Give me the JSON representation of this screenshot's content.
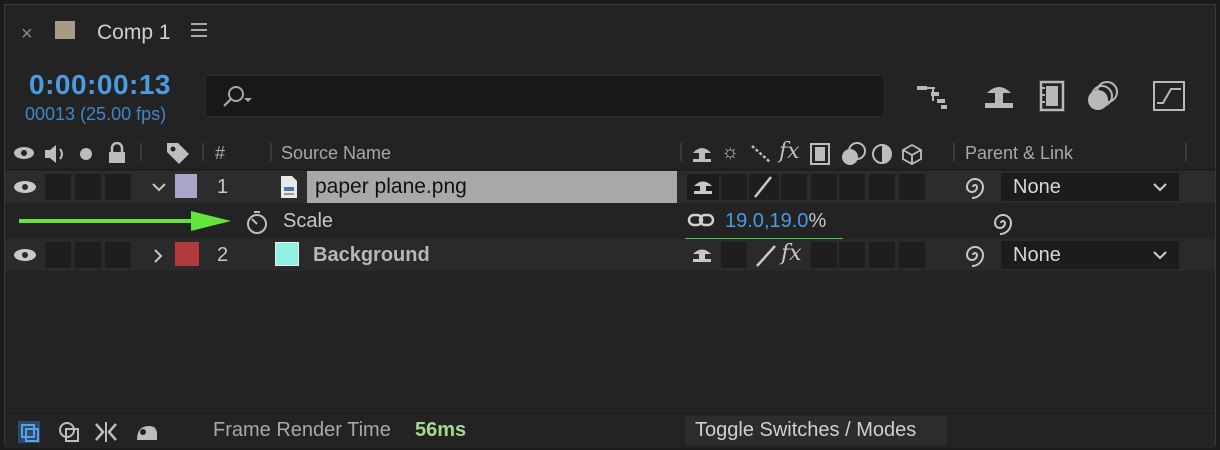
{
  "tab": {
    "close": "×",
    "title": "Comp 1",
    "swatch_color": "#a99a86"
  },
  "time": {
    "timecode": "0:00:00:13",
    "frames": "00013 (25.00 fps)"
  },
  "search": {
    "placeholder": ""
  },
  "toolbar": {
    "icons": [
      "composition-flowchart-icon",
      "draft-3d-icon",
      "frame-blending-icon",
      "motion-blur-icon",
      "graph-editor-icon"
    ]
  },
  "columns": {
    "index": "#",
    "source_name": "Source Name",
    "parent_link": "Parent & Link"
  },
  "layers": [
    {
      "number": "1",
      "name": "paper plane.png",
      "label_color": "#a8a6c8",
      "expanded": true,
      "parent": "None"
    },
    {
      "number": "2",
      "name": "Background",
      "label_color": "#b23a3a",
      "swatch_color": "#8ff0e3",
      "expanded": false,
      "parent": "None"
    }
  ],
  "property": {
    "name": "Scale",
    "value_x": "19.0",
    "comma": ",",
    "value_y": "19.0",
    "unit": "%"
  },
  "annotation": {
    "arrow_color": "#62e43a",
    "underline_color": "#36d13a"
  },
  "footer": {
    "render_label": "Frame Render Time",
    "render_value": "56ms",
    "toggle_label": "Toggle Switches / Modes"
  }
}
